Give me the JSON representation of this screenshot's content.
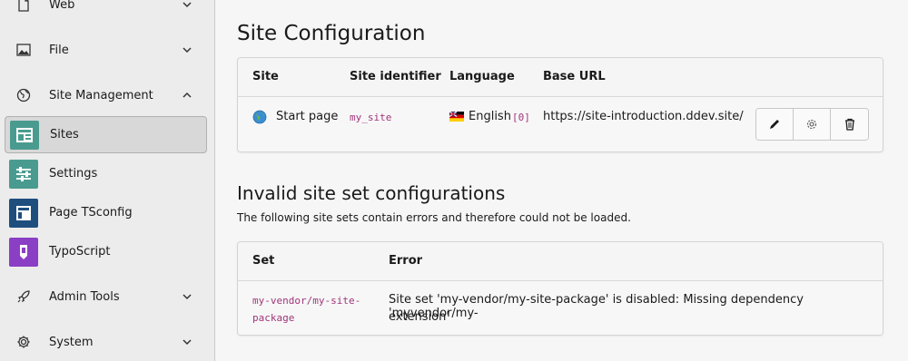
{
  "sidebar": {
    "groups": [
      {
        "label": "Web",
        "icon": "file-icon"
      },
      {
        "label": "File",
        "icon": "image-icon"
      },
      {
        "label": "Site Management",
        "icon": "globe-icon"
      },
      {
        "label": "Admin Tools",
        "icon": "rocket-icon"
      },
      {
        "label": "System",
        "icon": "gear-icon"
      }
    ],
    "modules": [
      {
        "label": "Sites",
        "color": "#4a9b8f",
        "active": true
      },
      {
        "label": "Settings",
        "color": "#4a9b8f"
      },
      {
        "label": "Page TSconfig",
        "color": "#1e4e7e"
      },
      {
        "label": "TypoScript",
        "color": "#8a3fc4"
      }
    ]
  },
  "main": {
    "title": "Site Configuration",
    "sites_table": {
      "headers": [
        "Site",
        "Site identifier",
        "Language",
        "Base URL"
      ],
      "rows": [
        {
          "site": "Start page",
          "identifier": "my_site",
          "language": "English",
          "language_id": "[0]",
          "base_url": "https://site-introduction.ddev.site/"
        }
      ]
    },
    "invalid": {
      "title": "Invalid site set configurations",
      "description": "The following site sets contain errors and therefore could not be loaded.",
      "headers": [
        "Set",
        "Error"
      ],
      "rows": [
        {
          "set_line1": "my-vendor/my-site-",
          "set_line2": "package",
          "error_line1": "Site set 'my-vendor/my-site-package' is disabled: Missing dependency 'myvendor/my-",
          "error_line2": "extension'"
        }
      ]
    }
  }
}
